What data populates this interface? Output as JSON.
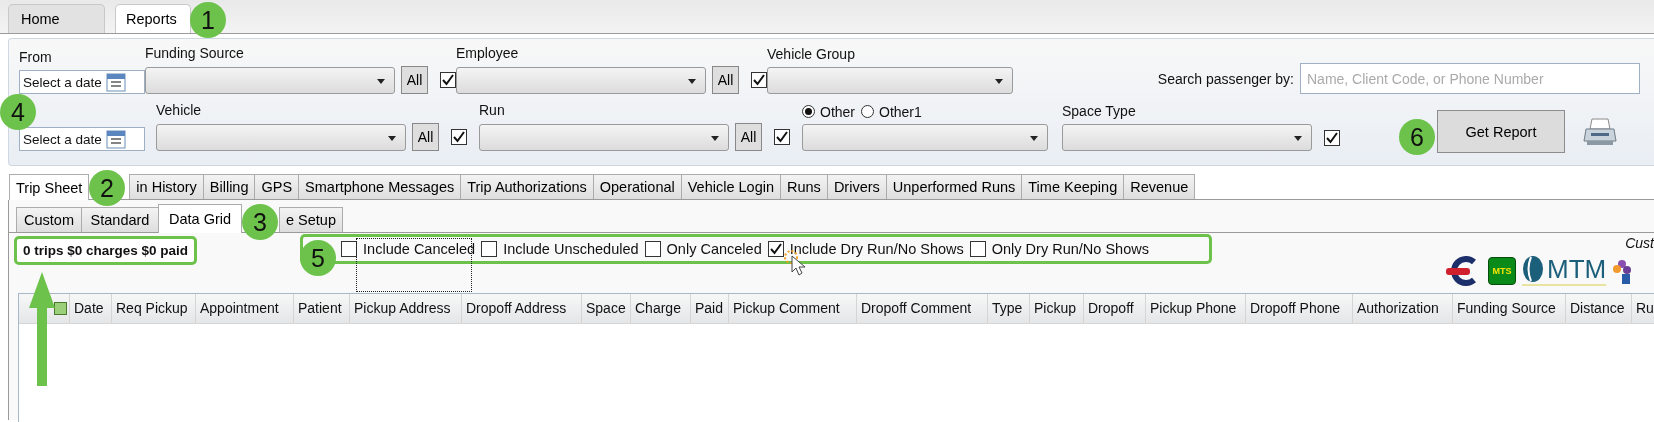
{
  "top_tabs": [
    {
      "label": "Home",
      "selected": false
    },
    {
      "label": "Reports",
      "selected": true
    }
  ],
  "filters": {
    "rows": [
      [
        {
          "kind": "date",
          "label": "From",
          "placeholder": "Select a date"
        },
        {
          "kind": "combo",
          "label": "Funding Source",
          "all_button": "All",
          "checked": true
        },
        {
          "kind": "combo",
          "label": "Employee",
          "all_button": "All",
          "checked": true
        },
        {
          "kind": "combo",
          "label": "Vehicle Group"
        },
        "",
        {
          "kind": "search",
          "label": "Search passenger by:",
          "placeholder": "Name, Client Code, or Phone Number"
        }
      ],
      [
        {
          "kind": "date",
          "placeholder": "Select a date"
        },
        {
          "kind": "combo",
          "label": "Vehicle",
          "all_button": "All",
          "checked": true
        },
        {
          "kind": "combo",
          "label": "Run",
          "all_button": "All",
          "checked": true
        },
        {
          "kind": "radio_combo",
          "options": [
            {
              "label": "Other",
              "selected": true
            },
            {
              "label": "Other1",
              "selected": false
            }
          ]
        },
        {
          "kind": "combo",
          "label": "Space Type",
          "checked": true
        },
        {
          "kind": "button",
          "label": "Get Report"
        },
        {
          "kind": "print"
        }
      ]
    ]
  },
  "main_tabs": [
    {
      "label": "Trip Sheet",
      "selected": true
    },
    {
      "label": "in History",
      "selected": false
    },
    {
      "label": "Billing",
      "selected": false
    },
    {
      "label": "GPS",
      "selected": false
    },
    {
      "label": "Smartphone Messages",
      "selected": false
    },
    {
      "label": "Trip Authorizations",
      "selected": false
    },
    {
      "label": "Operational",
      "selected": false
    },
    {
      "label": "Vehicle Login",
      "selected": false
    },
    {
      "label": "Runs",
      "selected": false
    },
    {
      "label": "Drivers",
      "selected": false
    },
    {
      "label": "Unperformed Runs",
      "selected": false
    },
    {
      "label": "Time Keeping",
      "selected": false
    },
    {
      "label": "Revenue",
      "selected": false
    }
  ],
  "sub_tabs": [
    {
      "label": "Custom",
      "selected": false
    },
    {
      "label": "Standard",
      "selected": false
    },
    {
      "label": "Data Grid",
      "selected": true
    },
    {
      "label": "e Setup",
      "selected": false
    }
  ],
  "summary": "0 trips $0 charges $0 paid",
  "options": [
    {
      "label": "Include Canceled",
      "checked": false,
      "focused": true
    },
    {
      "label": "Include Unscheduled",
      "checked": false,
      "focused": false
    },
    {
      "label": "Only Canceled",
      "checked": false,
      "focused": false
    },
    {
      "label": "Include Dry Run/No Shows",
      "checked": true,
      "focused": false
    },
    {
      "label": "Only Dry Run/No Shows",
      "checked": false,
      "focused": false
    }
  ],
  "customer_label": "Cust",
  "logos": [
    {
      "kind": "c"
    },
    {
      "kind": "badge",
      "text": "MTS"
    },
    {
      "kind": "wordmark",
      "text": "MTM"
    },
    {
      "kind": "flower"
    }
  ],
  "table": {
    "columns": [
      "Date",
      "Req Pickup",
      "Appointment",
      "Patient",
      "Pickup Address",
      "Dropoff Address",
      "Space",
      "Charge",
      "Paid",
      "Pickup Comment",
      "Dropoff Comment",
      "Type",
      "Pickup",
      "Dropoff",
      "Pickup Phone",
      "Dropoff Phone",
      "Authorization",
      "Funding Source",
      "Distance",
      "Ru"
    ]
  },
  "callouts": [
    "1",
    "2",
    "3",
    "4",
    "5",
    "6"
  ]
}
